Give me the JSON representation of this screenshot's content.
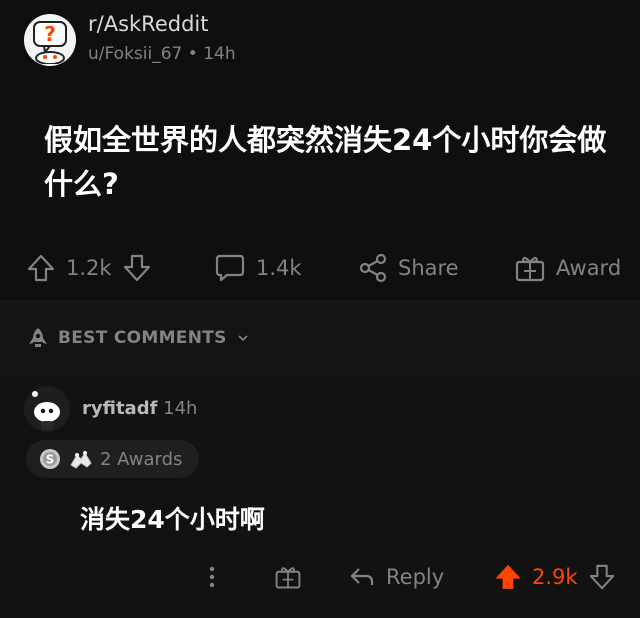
{
  "post": {
    "subreddit": "r/AskReddit",
    "author": "u/Foksii_67",
    "separator": "•",
    "time": "14h",
    "title": "假如全世界的人都突然消失24个小时你会做什么?",
    "votes": "1.2k",
    "comments": "1.4k",
    "share_label": "Share",
    "award_label": "Award"
  },
  "sort": {
    "label": "BEST COMMENTS"
  },
  "comment": {
    "author": "ryfitadf",
    "time": "14h",
    "awards_label": "2 Awards",
    "body": "消失24个小时啊",
    "reply_label": "Reply",
    "votes": "2.9k"
  },
  "colors": {
    "upvoted": "#ff4500",
    "muted": "#818384",
    "text": "#ffffff"
  }
}
